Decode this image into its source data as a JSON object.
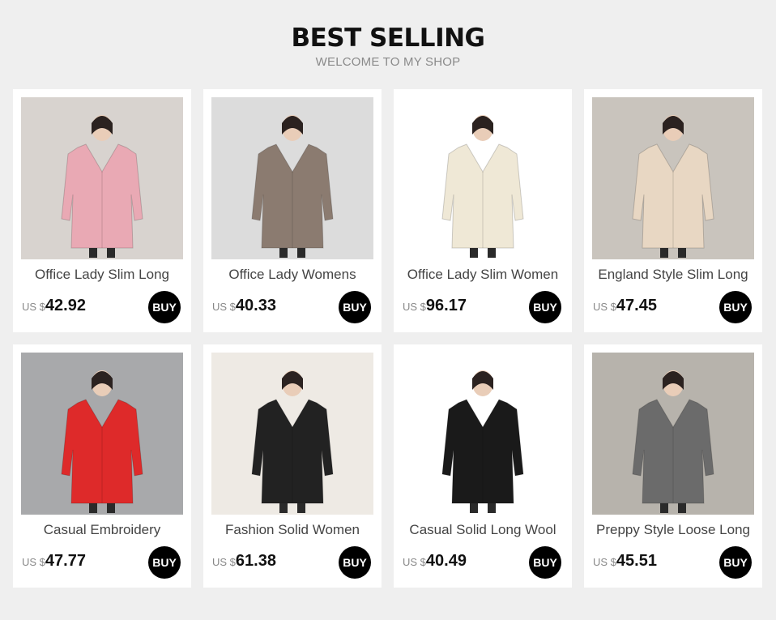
{
  "header": {
    "title": "BEST SELLING",
    "subtitle": "WELCOME TO MY SHOP"
  },
  "products": [
    {
      "name": "Office Lady Slim Long",
      "currency": "US $",
      "price": "42.92",
      "buy_label": "BUY",
      "coat_color": "#e9a9b4",
      "bg_color": "#d8d3cf"
    },
    {
      "name": "Office Lady Womens",
      "currency": "US $",
      "price": "40.33",
      "buy_label": "BUY",
      "coat_color": "#8b7b70",
      "bg_color": "#dcdcdc"
    },
    {
      "name": "Office Lady Slim Women",
      "currency": "US $",
      "price": "96.17",
      "buy_label": "BUY",
      "coat_color": "#efe8d6",
      "bg_color": "#ffffff"
    },
    {
      "name": "England Style Slim Long",
      "currency": "US $",
      "price": "47.45",
      "buy_label": "BUY",
      "coat_color": "#e8d7c3",
      "bg_color": "#c9c4bd"
    },
    {
      "name": "Casual Embroidery",
      "currency": "US $",
      "price": "47.77",
      "buy_label": "BUY",
      "coat_color": "#de2a2a",
      "bg_color": "#a8a9ab"
    },
    {
      "name": "Fashion Solid Women",
      "currency": "US $",
      "price": "61.38",
      "buy_label": "BUY",
      "coat_color": "#222222",
      "bg_color": "#eeeae4"
    },
    {
      "name": "Casual Solid Long Wool",
      "currency": "US $",
      "price": "40.49",
      "buy_label": "BUY",
      "coat_color": "#1a1a1a",
      "bg_color": "#ffffff"
    },
    {
      "name": "Preppy Style Loose Long",
      "currency": "US $",
      "price": "45.51",
      "buy_label": "BUY",
      "coat_color": "#6b6b6b",
      "bg_color": "#b7b3ac"
    }
  ]
}
